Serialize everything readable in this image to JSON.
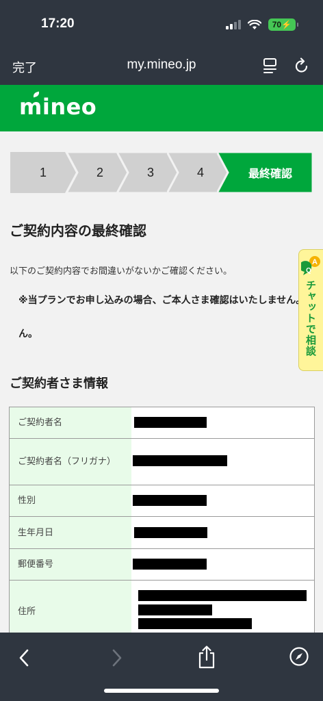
{
  "status_bar": {
    "time": "17:20",
    "battery": "70"
  },
  "nav": {
    "done_label": "完了",
    "url": "my.mineo.jp"
  },
  "brand": {
    "logo_text": "mineo"
  },
  "steps": [
    {
      "label": "1",
      "active": false
    },
    {
      "label": "2",
      "active": false
    },
    {
      "label": "3",
      "active": false
    },
    {
      "label": "4",
      "active": false
    },
    {
      "label": "最終確認",
      "active": true
    }
  ],
  "page": {
    "title": "ご契約内容の最終確認",
    "intro": "以下のご契約内容でお間違いがないかご確認ください。",
    "notice_line1": "※当プランでお申し込みの場合、ご本人さま確認はいたしません。",
    "notice_line2": "ん。",
    "section_title": "ご契約者さま情報"
  },
  "table": {
    "rows": [
      {
        "label": "ご契約者名"
      },
      {
        "label": "ご契約者名（フリガナ）"
      },
      {
        "label": "性別"
      },
      {
        "label": "生年月日"
      },
      {
        "label": "郵便番号"
      },
      {
        "label": "住所"
      }
    ]
  },
  "chat": {
    "label": "チャットで相談",
    "icon": "chat-qa-icon"
  },
  "colors": {
    "brand_green": "#00a73c",
    "dark_chrome": "#2f3640",
    "step_gray": "#d0d0d0",
    "chat_yellow": "#fff59a"
  }
}
